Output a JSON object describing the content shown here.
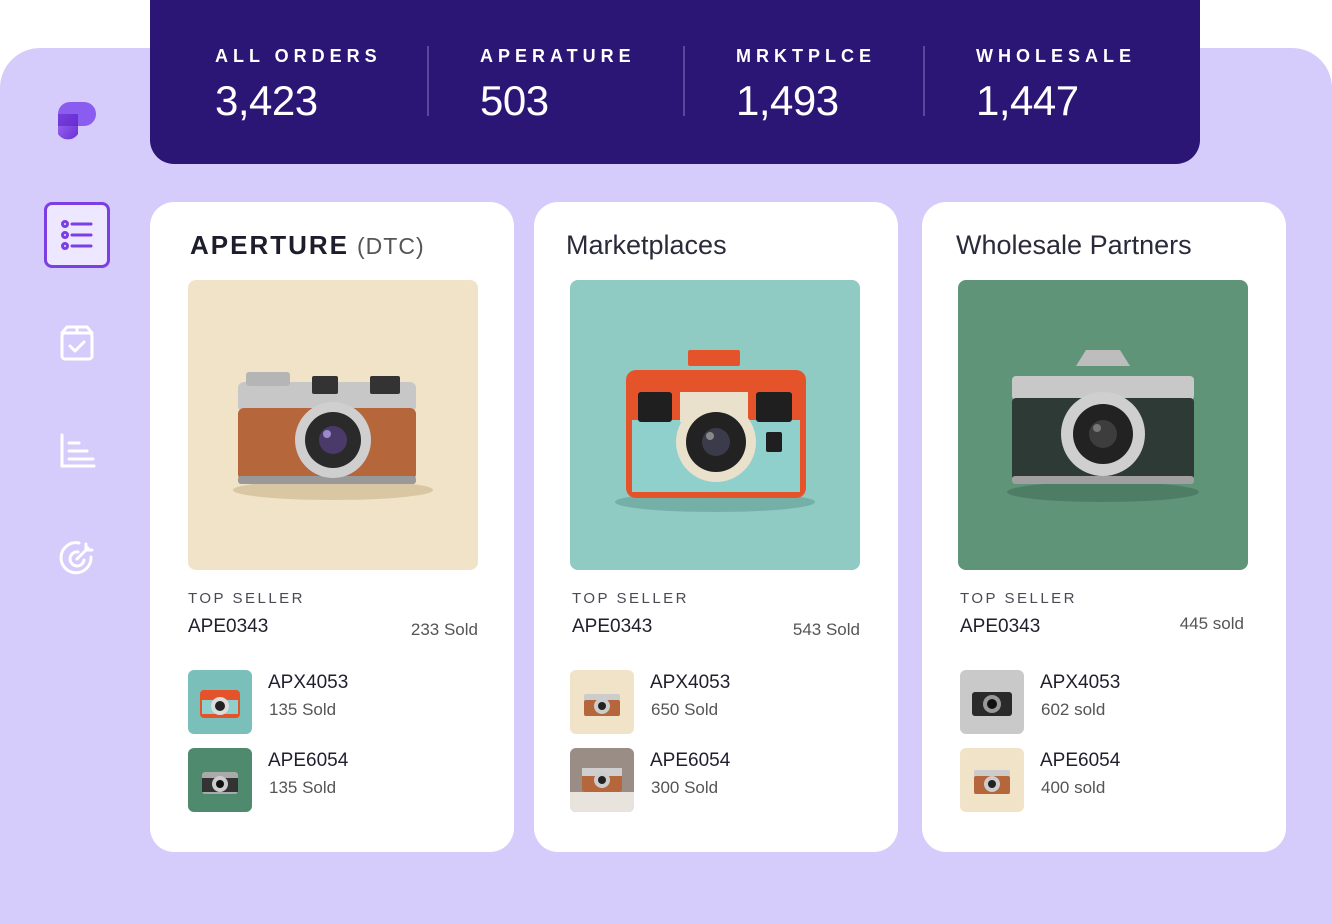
{
  "stats": [
    {
      "label": "ALL ORDERS",
      "value": "3,423"
    },
    {
      "label": "APERATURE",
      "value": "503"
    },
    {
      "label": "MRKTPLCE",
      "value": "1,493"
    },
    {
      "label": "WHOLESALE",
      "value": "1,447"
    }
  ],
  "sidebar": {
    "items": [
      {
        "icon": "orders-list-icon",
        "active": true
      },
      {
        "icon": "package-check-icon",
        "active": false
      },
      {
        "icon": "bar-chart-icon",
        "active": false
      },
      {
        "icon": "target-icon",
        "active": false
      }
    ]
  },
  "cards": [
    {
      "title_brand": "APERTURE",
      "title_sub": "(DTC)",
      "top_label": "TOP SELLER",
      "top_code": "APE0343",
      "top_sold": "233 Sold",
      "items": [
        {
          "code": "APX4053",
          "sold": "135  Sold"
        },
        {
          "code": "APE6054",
          "sold": "135 Sold"
        }
      ]
    },
    {
      "title": "Marketplaces",
      "top_label": "TOP SELLER",
      "top_code": "APE0343",
      "top_sold": "543 Sold",
      "items": [
        {
          "code": "APX4053",
          "sold": "650 Sold"
        },
        {
          "code": "APE6054",
          "sold": "300 Sold"
        }
      ]
    },
    {
      "title": "Wholesale Partners",
      "top_label": "TOP SELLER",
      "top_code": "APE0343",
      "top_sold": "445 sold",
      "items": [
        {
          "code": "APX4053",
          "sold": "602 sold"
        },
        {
          "code": "APE6054",
          "sold": "400 sold"
        }
      ]
    }
  ],
  "colors": {
    "banner": "#2c1675",
    "panel": "#d5ccfb",
    "accent": "#7b3fe4"
  }
}
